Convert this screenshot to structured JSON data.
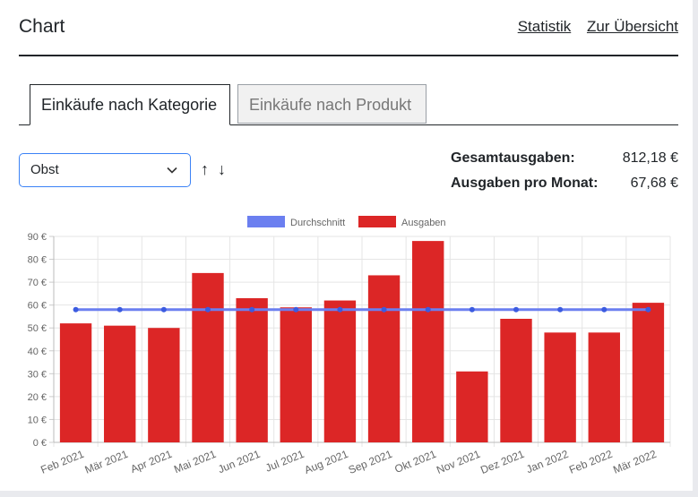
{
  "header": {
    "title": "Chart",
    "links": [
      "Statistik",
      "Zur Übersicht"
    ]
  },
  "tabs": [
    "Einkäufe nach Kategorie",
    "Einkäufe nach Produkt"
  ],
  "category_select": {
    "value": "Obst"
  },
  "sort": {
    "up": "↑",
    "down": "↓"
  },
  "stats": {
    "total_label": "Gesamtausgaben:",
    "total_value": "812,18 €",
    "monthly_label": "Ausgaben pro Monat:",
    "monthly_value": "67,68 €"
  },
  "colors": {
    "bar": "#dc2626",
    "line": "#6b7ff0",
    "grid": "#e5e5e5",
    "select_border": "#3b82f6"
  },
  "chart_data": {
    "type": "bar",
    "categories": [
      "Feb 2021",
      "Mär 2021",
      "Apr 2021",
      "Mai 2021",
      "Jun 2021",
      "Jul 2021",
      "Aug 2021",
      "Sep 2021",
      "Okt 2021",
      "Nov 2021",
      "Dez 2021",
      "Jan 2022",
      "Feb 2022",
      "Mär 2022"
    ],
    "series": [
      {
        "name": "Ausgaben",
        "type": "bar",
        "values": [
          52,
          51,
          50,
          74,
          63,
          59,
          62,
          73,
          88,
          31,
          54,
          48,
          48,
          61
        ]
      },
      {
        "name": "Durchschnitt",
        "type": "line",
        "values": [
          58,
          58,
          58,
          58,
          58,
          58,
          58,
          58,
          58,
          58,
          58,
          58,
          58,
          58
        ]
      }
    ],
    "ylim": [
      0,
      90
    ],
    "yticks": [
      "0 €",
      "10 €",
      "20 €",
      "30 €",
      "40 €",
      "50 €",
      "60 €",
      "70 €",
      "80 €",
      "90 €"
    ],
    "legend": "top-center",
    "grid": true
  }
}
